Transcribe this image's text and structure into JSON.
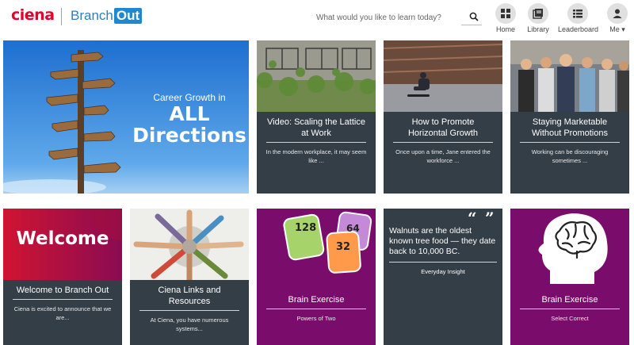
{
  "brand": {
    "company": "ciena",
    "product_prefix": "Branch",
    "product_suffix": "Out",
    "color": "#e4002b",
    "accent": "#1f88cf"
  },
  "search": {
    "placeholder": "What would you like to learn today?",
    "icon": "search-icon"
  },
  "nav": [
    {
      "label": "Home",
      "icon": "grid-icon"
    },
    {
      "label": "Library",
      "icon": "book-icon"
    },
    {
      "label": "Leaderboard",
      "icon": "list-icon"
    },
    {
      "label": "Me",
      "icon": "person-icon",
      "caret": "▾"
    }
  ],
  "hero": {
    "line1": "Career Growth in",
    "line2": "ALL",
    "line3": "Directions"
  },
  "row1": [
    {
      "title": "Video: Scaling the Lattice at Work",
      "desc": "In the modern workplace, it may seem like ..."
    },
    {
      "title": "How to Promote Horizontal Growth",
      "desc": "Once upon a time, Jane entered the workforce ..."
    },
    {
      "title": "Staying Marketable Without Promotions",
      "desc": "Working can be discouraging sometimes ..."
    }
  ],
  "row2": [
    {
      "image_text": "Welcome",
      "title": "Welcome to Branch Out",
      "desc": "Ciena is excited to announce that we are..."
    },
    {
      "title": "Ciena Links and Resources",
      "desc": "At Ciena, you have numerous systems..."
    },
    {
      "title": "Brain Exercise",
      "desc": "Powers of Two",
      "cards": [
        "128",
        "64",
        "32"
      ]
    },
    {
      "quote": "Walnuts are the oldest known tree food — they date back to 10,000 BC.",
      "desc": "Everyday Insight"
    },
    {
      "title": "Brain Exercise",
      "desc": "Select Correct"
    }
  ],
  "colors": {
    "panel": "#343e46",
    "purple": "#7a0d6b",
    "sky": "#2f7fd0",
    "red": "#c8102e"
  }
}
